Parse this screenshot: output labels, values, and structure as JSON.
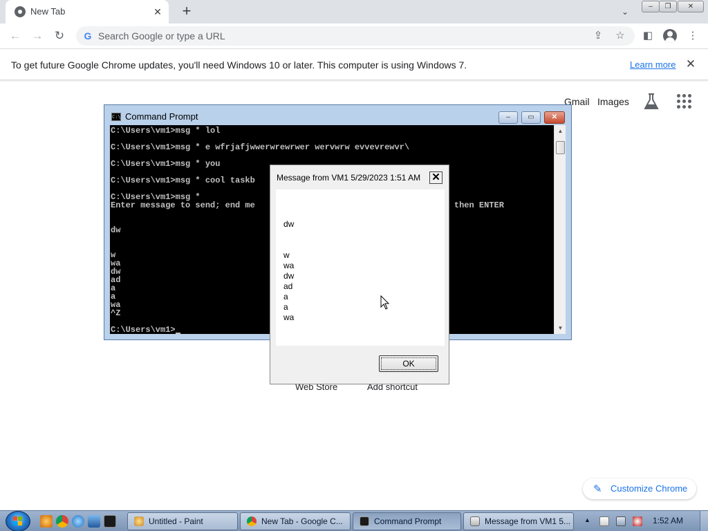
{
  "browser": {
    "tab": {
      "title": "New Tab",
      "close": "✕"
    },
    "new_tab": "+",
    "tab_search": "⌄",
    "window_controls": {
      "minimize": "–",
      "maximize": "❐",
      "close": "✕"
    },
    "nav": {
      "back": "←",
      "forward": "→",
      "reload": "↻"
    },
    "omnibox": {
      "g_icon": "G",
      "placeholder": "Search Google or type a URL"
    },
    "omnibox_icons": [
      "share-icon",
      "star-icon"
    ],
    "toolbar_icons": [
      "sidepanel-icon",
      "profile-icon",
      "menu-icon"
    ],
    "share_glyph": "⇪",
    "star_glyph": "☆",
    "sidepanel_glyph": "◧",
    "menu_glyph": "⋮",
    "accent": "#1a73e8"
  },
  "infobar": {
    "message": "To get future Google Chrome updates, you'll need Windows 10 or later. This computer is using Windows 7.",
    "link": "Learn more",
    "close": "✕"
  },
  "ntp": {
    "links": {
      "gmail": "Gmail",
      "images": "Images"
    },
    "shortcuts": {
      "web_store": "Web Store",
      "add_shortcut": "Add shortcut"
    },
    "customize": {
      "icon": "✎",
      "label": "Customize Chrome"
    }
  },
  "cmd_window": {
    "title": "Command Prompt",
    "icon_text": "C:\\",
    "controls": {
      "minimize": "–",
      "maximize": "▭",
      "close": "✕"
    },
    "lines": [
      "C:\\Users\\vm1>msg * lol",
      "",
      "C:\\Users\\vm1>msg * e wfrjafjwwerwrewrwer wervwrw evvevrewvr\\",
      "",
      "C:\\Users\\vm1>msg * you",
      "",
      "C:\\Users\\vm1>msg * cool taskb",
      "",
      "C:\\Users\\vm1>msg *",
      "Enter message to send; end me                                w line, then ENTER",
      "",
      "",
      "dw",
      "",
      "",
      "w",
      "wa",
      "dw",
      "ad",
      "a",
      "a",
      "wa",
      "^Z",
      "",
      "C:\\Users\\vm1>"
    ],
    "scroll_up": "▲",
    "scroll_down": "▼"
  },
  "msg_dialog": {
    "title": "Message from VM1 5/29/2023 1:51 AM",
    "close": "✕",
    "body_lines": [
      "dw",
      "w",
      "wa",
      "dw",
      "ad",
      "a",
      "a",
      "wa"
    ],
    "ok": "OK"
  },
  "taskbar": {
    "quicklaunch": [
      "search-everything-icon",
      "chrome-icon",
      "ie-icon",
      "desktop-icon",
      "cmd-icon"
    ],
    "buttons": [
      {
        "label": "Untitled - Paint"
      },
      {
        "label": "New Tab - Google C..."
      },
      {
        "label": "Command Prompt"
      },
      {
        "label": "Message from VM1 5..."
      }
    ],
    "tray_arrow": "▲",
    "clock": "1:52 AM"
  }
}
